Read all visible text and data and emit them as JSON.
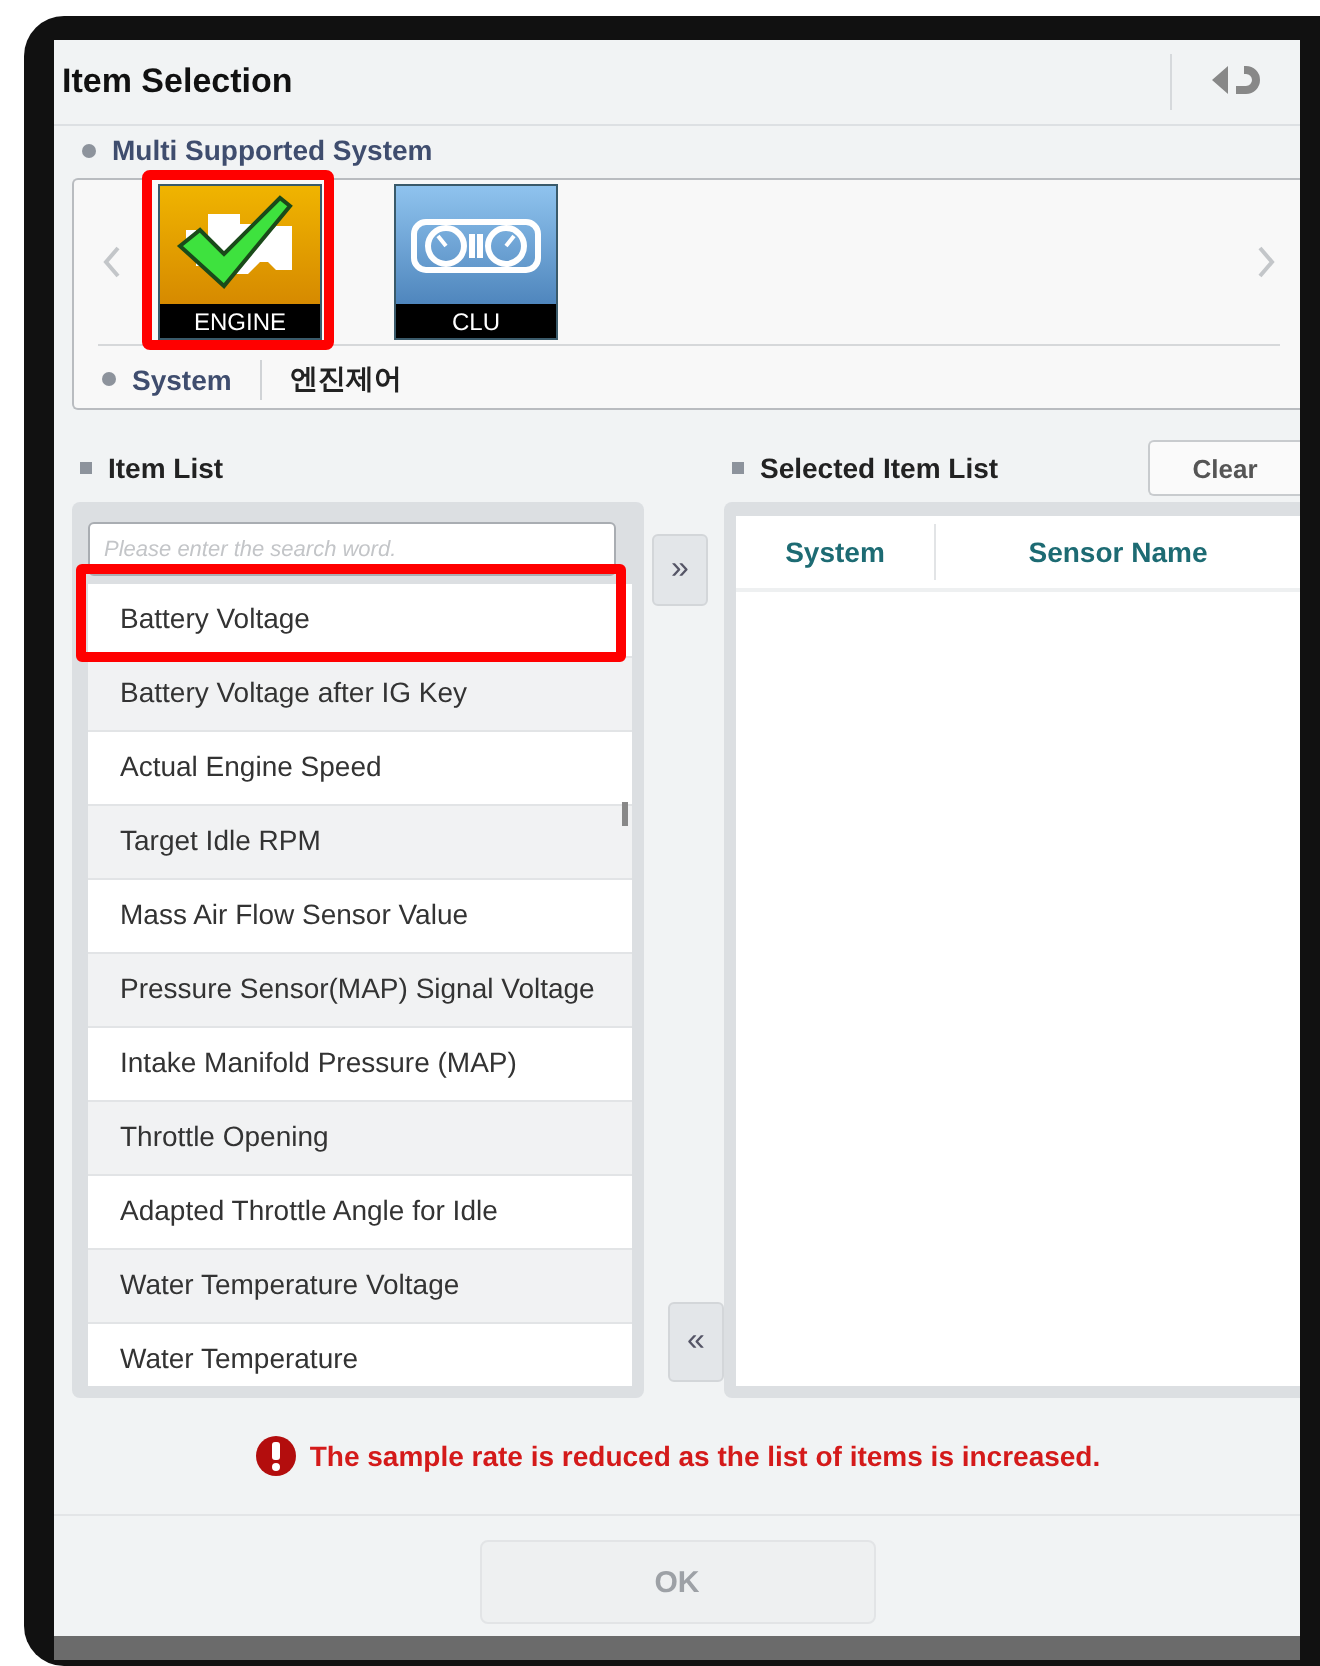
{
  "window": {
    "title": "Item Selection"
  },
  "multi_supported_system": {
    "label": "Multi Supported System",
    "systems": [
      {
        "label": "ENGINE",
        "kind": "engine",
        "selected": true,
        "highlighted": true
      },
      {
        "label": "CLU",
        "kind": "cluster",
        "selected": false,
        "highlighted": false
      }
    ]
  },
  "system": {
    "label": "System",
    "value": "엔진제어"
  },
  "item_list": {
    "label": "Item List",
    "search": {
      "placeholder": "Please enter the search word."
    },
    "items": [
      {
        "label": "Battery Voltage",
        "highlighted": true
      },
      {
        "label": "Battery Voltage after IG Key",
        "highlighted": false
      },
      {
        "label": "Actual Engine Speed",
        "highlighted": false
      },
      {
        "label": "Target Idle RPM",
        "highlighted": false
      },
      {
        "label": "Mass Air Flow Sensor Value",
        "highlighted": false
      },
      {
        "label": "Pressure Sensor(MAP) Signal Voltage",
        "highlighted": false
      },
      {
        "label": "Intake Manifold Pressure (MAP)",
        "highlighted": false
      },
      {
        "label": "Throttle Opening",
        "highlighted": false
      },
      {
        "label": "Adapted Throttle Angle for Idle",
        "highlighted": false
      },
      {
        "label": "Water Temperature Voltage",
        "highlighted": false
      },
      {
        "label": "Water Temperature",
        "highlighted": false
      }
    ]
  },
  "add_button": "»",
  "remove_button": "«",
  "selected_item_list": {
    "label": "Selected Item List",
    "clear_button": "Clear",
    "columns": [
      "System",
      "Sensor Name"
    ]
  },
  "warning": "The sample rate is reduced as the list of items is increased.",
  "ok_button": {
    "label": "OK",
    "disabled": true
  }
}
